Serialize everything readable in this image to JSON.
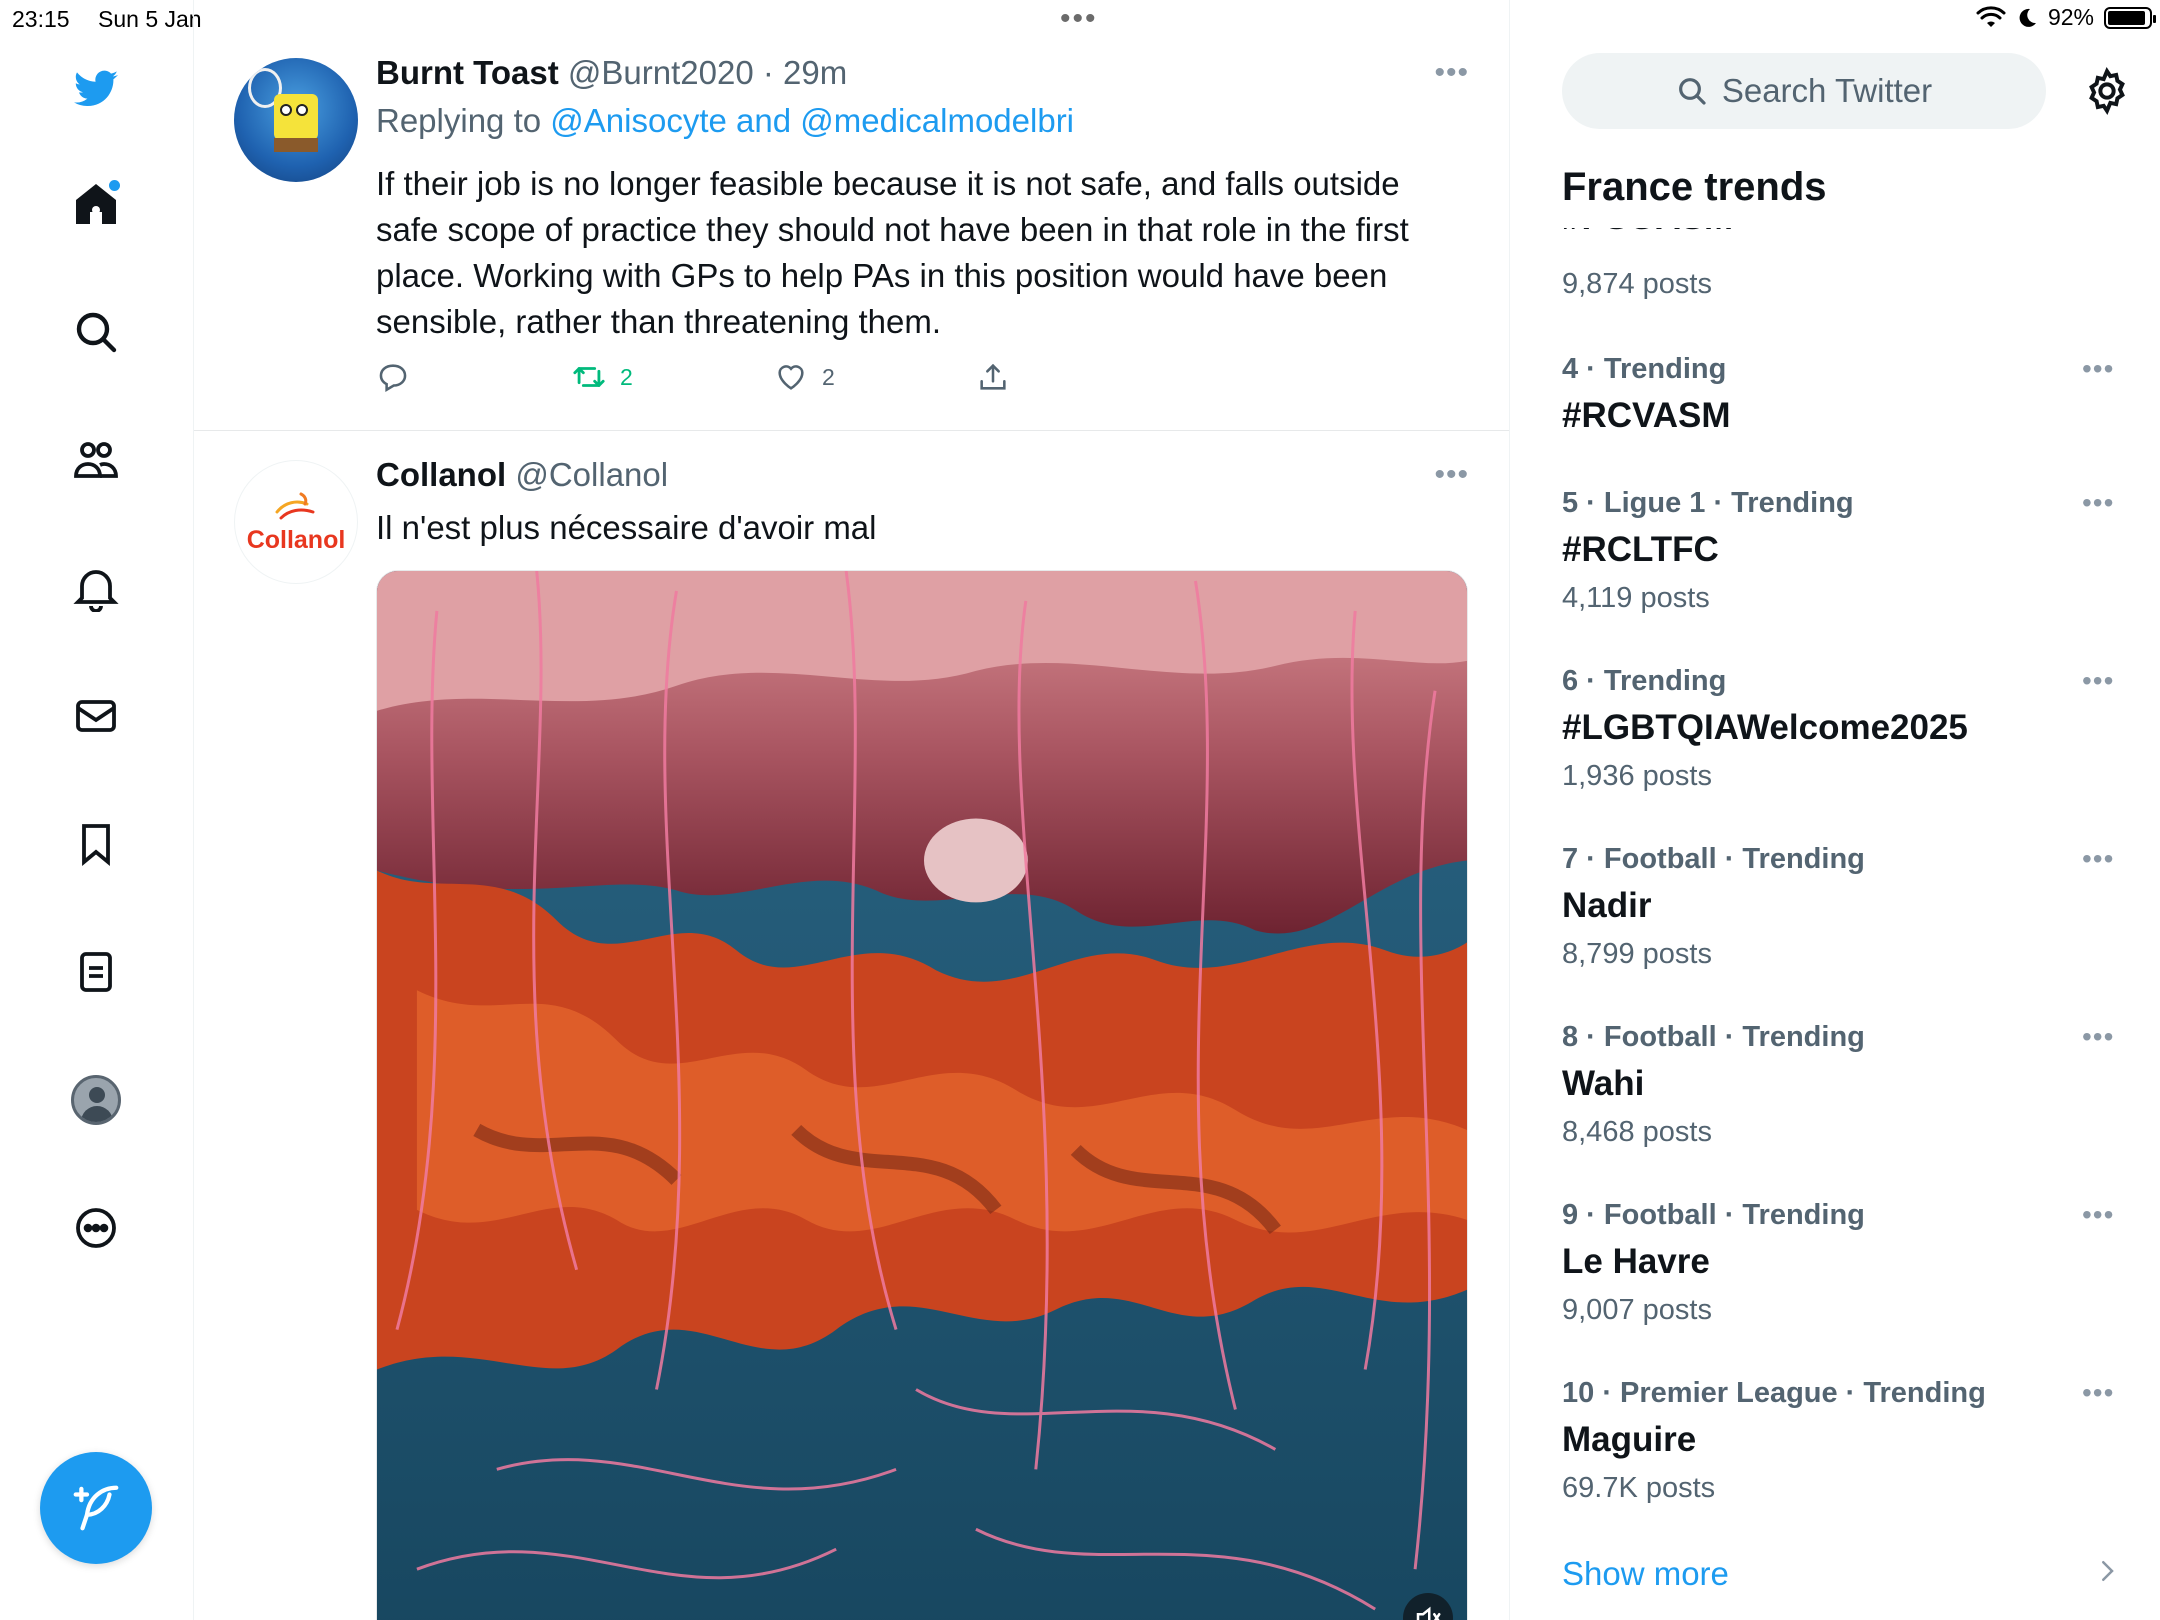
{
  "status_bar": {
    "time": "23:15",
    "date": "Sun 5 Jan",
    "dots": "•••",
    "battery": "92%",
    "battery_level": 0.92
  },
  "nav": {
    "items": [
      "twitter-logo",
      "home",
      "search",
      "communities",
      "notifications",
      "messages",
      "bookmarks",
      "lists",
      "profile",
      "more"
    ],
    "compose_icon": "compose-icon"
  },
  "tweets": [
    {
      "name": "Burnt Toast",
      "handle": "@Burnt2020",
      "separator": "·",
      "time": "29m",
      "more": "•••",
      "replying_prefix": "Replying to",
      "replying_to": "@Anisocyte and @medicalmodelbri",
      "text": "If their job is no longer feasible because it is not safe, and falls outside safe scope of practice they should not have been in that role in the first place. Working with GPs to help PAs in this position would have been sensible, rather than threatening them.",
      "retweets": "2",
      "likes": "2"
    },
    {
      "name": "Collanol",
      "handle": "@Collanol",
      "avatar_text": "Collanol",
      "more": "•••",
      "text": "Il n'est plus nécessaire d'avoir mal"
    }
  ],
  "right": {
    "search_placeholder": "Search Twitter",
    "trends_title": "France trends",
    "partial_trend": {
      "name": "#PSGASM",
      "count": "9,874 posts"
    },
    "trends": [
      {
        "meta": "4 · Trending",
        "name": "#RCVASM",
        "count": ""
      },
      {
        "meta": "5 · Ligue 1 · Trending",
        "name": "#RCLTFC",
        "count": "4,119 posts"
      },
      {
        "meta": "6 · Trending",
        "name": "#LGBTQIAWelcome2025",
        "count": "1,936 posts"
      },
      {
        "meta": "7 · Football · Trending",
        "name": "Nadir",
        "count": "8,799 posts"
      },
      {
        "meta": "8 · Football · Trending",
        "name": "Wahi",
        "count": "8,468 posts"
      },
      {
        "meta": "9 · Football · Trending",
        "name": "Le Havre",
        "count": "9,007 posts"
      },
      {
        "meta": "10 · Premier League · Trending",
        "name": "Maguire",
        "count": "69.7K posts"
      }
    ],
    "trend_more": "•••",
    "show_more": "Show more"
  },
  "colors": {
    "accent": "#1d9bf0",
    "retweet": "#00ba7c",
    "text_secondary": "#536471"
  }
}
